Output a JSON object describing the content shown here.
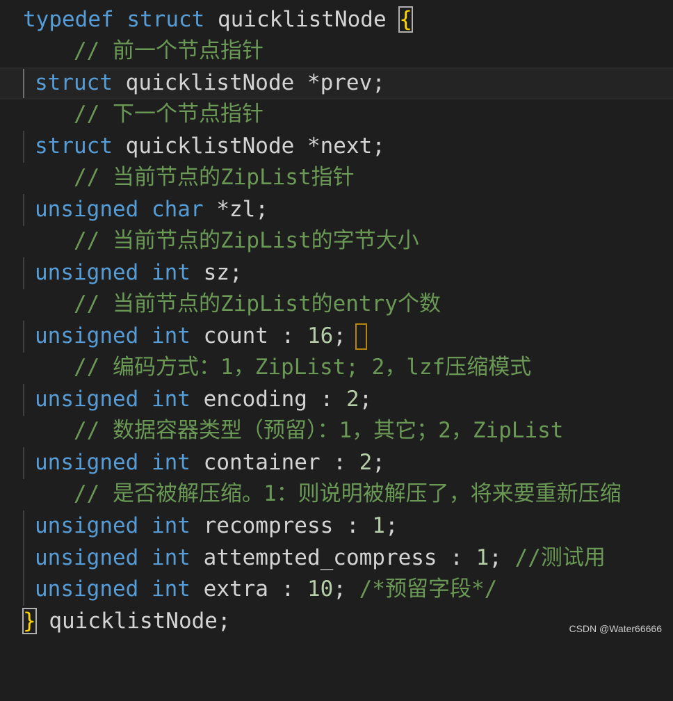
{
  "code_lines": [
    {
      "k1": "typedef",
      "k2": "struct",
      "rest": "quicklistNode",
      "brace": "{"
    },
    {
      "comment": "// 前一个节点指针"
    },
    {
      "kw": "struct",
      "rest": "quicklistNode *prev;"
    },
    {
      "comment": "// 下一个节点指针"
    },
    {
      "kw": "struct",
      "rest": "quicklistNode *next;"
    },
    {
      "comment": "// 当前节点的ZipList指针"
    },
    {
      "kw": "unsigned",
      "kw2": "char",
      "rest": "*zl;"
    },
    {
      "comment": "// 当前节点的ZipList的字节大小"
    },
    {
      "kw": "unsigned",
      "kw2": "int",
      "rest": "sz;"
    },
    {
      "comment": "// 当前节点的ZipList的entry个数"
    },
    {
      "kw": "unsigned",
      "kw2": "int",
      "rest": "count : ",
      "num": "16",
      "tail": ";"
    },
    {
      "comment": "// 编码方式：1，ZipList; 2，lzf压缩模式"
    },
    {
      "kw": "unsigned",
      "kw2": "int",
      "rest": "encoding : ",
      "num": "2",
      "tail": ";"
    },
    {
      "comment": "// 数据容器类型（预留）：1，其它；2，ZipList"
    },
    {
      "kw": "unsigned",
      "kw2": "int",
      "rest": "container : ",
      "num": "2",
      "tail": ";"
    },
    {
      "comment": "// 是否被解压缩。1：则说明被解压了，将来要重新压缩"
    },
    {
      "kw": "unsigned",
      "kw2": "int",
      "rest": "recompress : ",
      "num": "1",
      "tail": ";"
    },
    {
      "kw": "unsigned",
      "kw2": "int",
      "rest": "attempted_compress : ",
      "num": "1",
      "tail": "; ",
      "tailcomment": "//测试用"
    },
    {
      "kw": "unsigned",
      "kw2": "int",
      "rest": "extra : ",
      "num": "10",
      "tail": "; ",
      "tailcomment": "/*预留字段*/"
    },
    {
      "closebrace": "}",
      "rest": " quicklistNode;"
    }
  ],
  "watermark": "CSDN @Water66666",
  "colors": {
    "background": "#1e1e1e",
    "keyword": "#569cd6",
    "comment": "#6a9955",
    "number": "#b5cea8",
    "brace": "#ffd700",
    "text": "#d4d4d4"
  }
}
